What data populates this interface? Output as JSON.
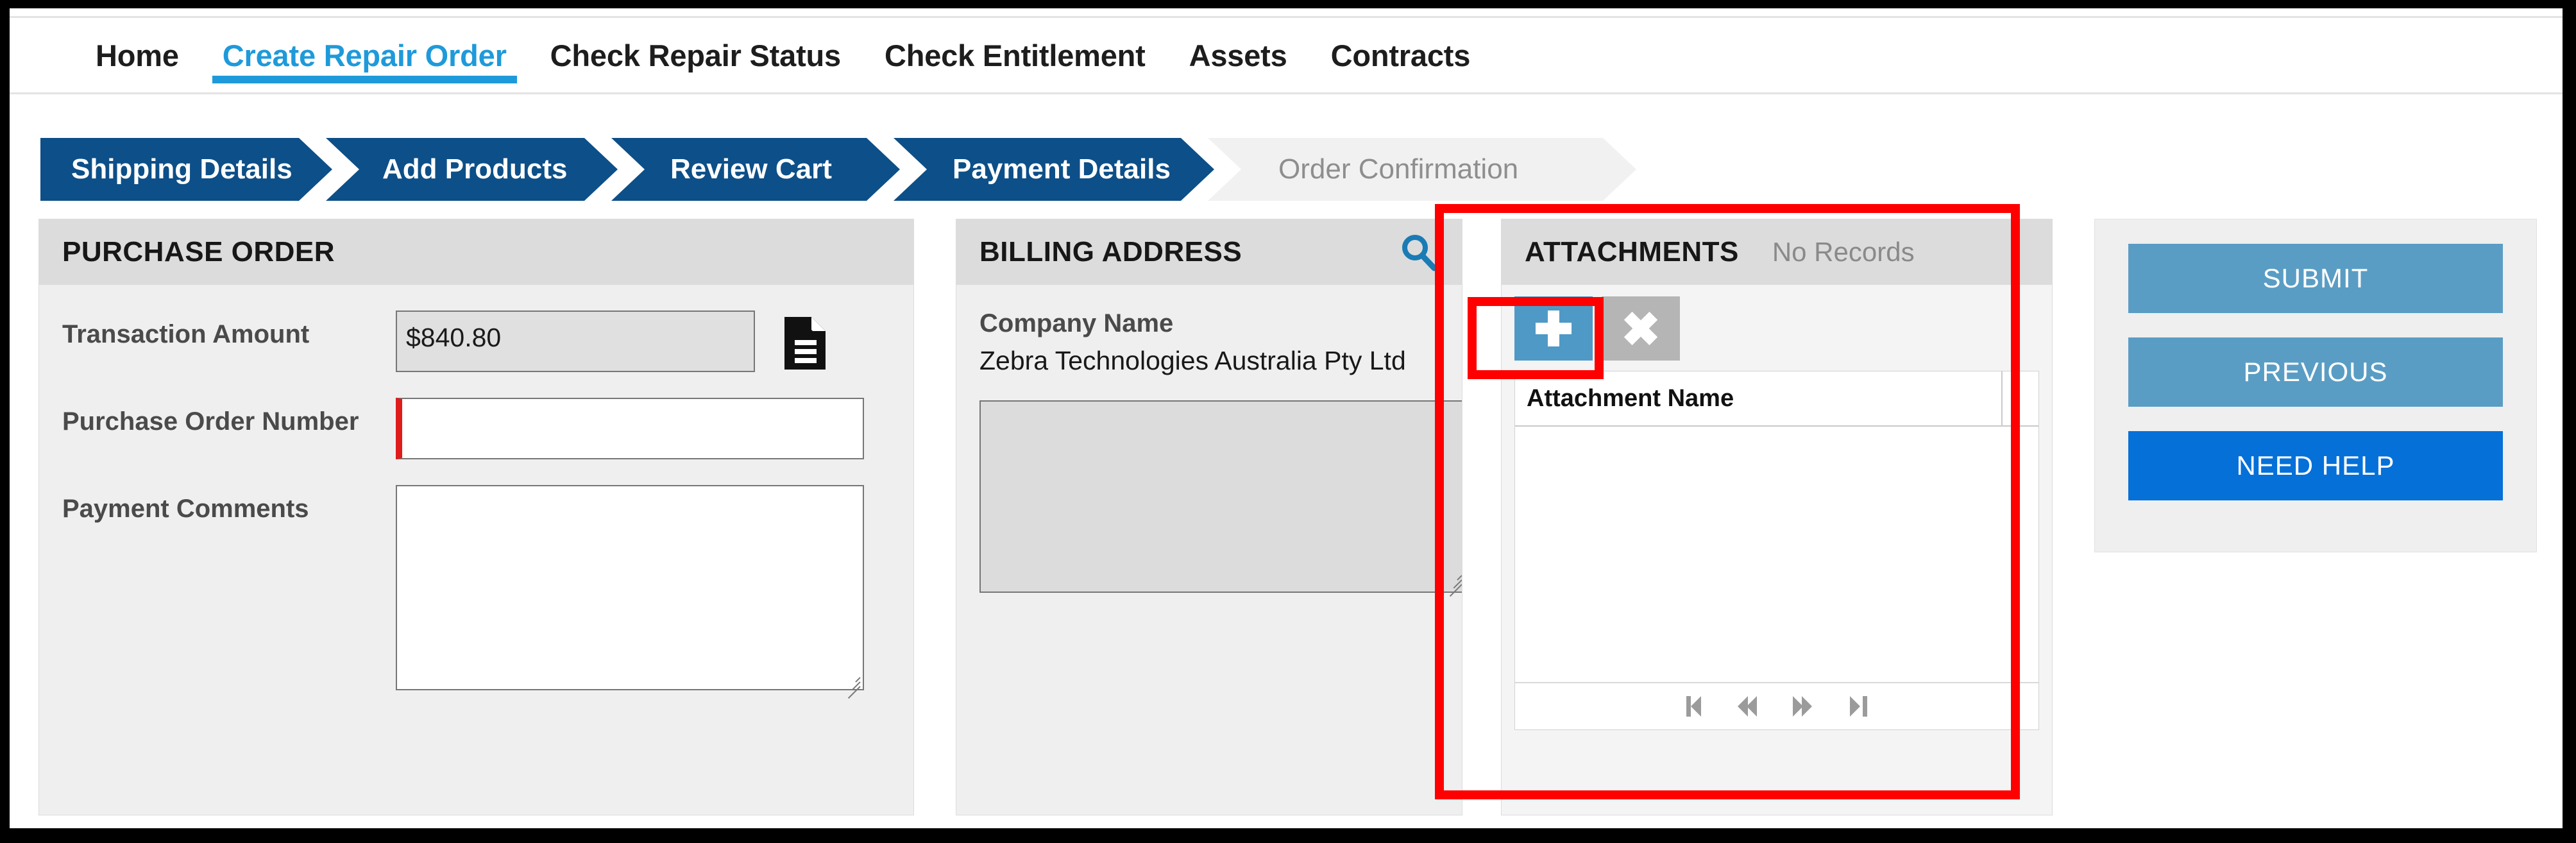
{
  "topnav": {
    "items": [
      {
        "label": "Home",
        "active": false
      },
      {
        "label": "Create Repair Order",
        "active": true
      },
      {
        "label": "Check Repair Status",
        "active": false
      },
      {
        "label": "Check Entitlement",
        "active": false
      },
      {
        "label": "Assets",
        "active": false
      },
      {
        "label": "Contracts",
        "active": false
      }
    ]
  },
  "steps": [
    {
      "label": "Shipping Details",
      "state": "done"
    },
    {
      "label": "Add Products",
      "state": "done"
    },
    {
      "label": "Review Cart",
      "state": "done"
    },
    {
      "label": "Payment Details",
      "state": "done"
    },
    {
      "label": "Order Confirmation",
      "state": "pending"
    }
  ],
  "purchase_order": {
    "title": "PURCHASE ORDER",
    "transaction_amount_label": "Transaction Amount",
    "transaction_amount_value": "$840.80",
    "document_icon": "document-icon",
    "po_number_label": "Purchase Order Number",
    "po_number_value": "",
    "po_number_placeholder": "",
    "payment_comments_label": "Payment Comments",
    "payment_comments_value": "",
    "payment_comments_placeholder": ""
  },
  "billing_address": {
    "title": "BILLING ADDRESS",
    "search_icon": "search-icon",
    "company_name_label": "Company Name",
    "company_name_value": "Zebra Technologies Australia Pty Ltd",
    "address_value": ""
  },
  "attachments": {
    "title": "ATTACHMENTS",
    "status": "No Records",
    "add_icon": "plus-icon",
    "delete_icon": "close-icon",
    "columns": [
      "Attachment Name"
    ],
    "rows": [],
    "pager": {
      "first": "first-page-icon",
      "prev": "previous-page-icon",
      "next": "next-page-icon",
      "last": "last-page-icon"
    }
  },
  "actions": {
    "submit_label": "SUBMIT",
    "previous_label": "PREVIOUS",
    "need_help_label": "NEED HELP"
  },
  "colors": {
    "accent_blue": "#1e9ada",
    "step_done": "#0d4f88",
    "step_pending_bg": "#f1f1f1",
    "button_secondary": "#5a9dc4",
    "button_primary": "#0570d8",
    "required_marker": "#e01b1b",
    "annotation": "#ff0000"
  }
}
